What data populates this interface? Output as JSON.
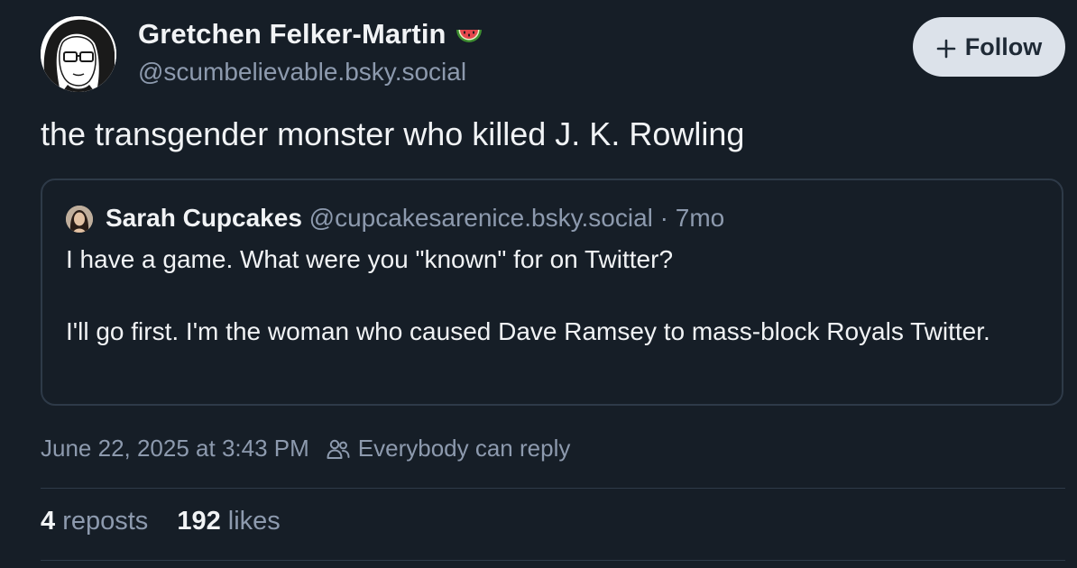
{
  "author": {
    "name": "Gretchen Felker-Martin",
    "handle": "@scumbelievable.bsky.social",
    "name_badge_icon": "watermelon-icon"
  },
  "follow_button": {
    "icon": "plus-icon",
    "label": "Follow"
  },
  "post": {
    "text": "the transgender monster who killed J. K. Rowling"
  },
  "quoted_post": {
    "author_name": "Sarah Cupcakes",
    "author_handle": "@cupcakesarenice.bsky.social",
    "separator": "·",
    "age": "7mo",
    "paragraphs": [
      "I have a game. What were you \"known\" for on Twitter?",
      "I'll go first. I'm the woman who caused Dave Ramsey to mass-block Royals Twitter."
    ]
  },
  "meta": {
    "timestamp": "June 22, 2025 at 3:43 PM",
    "reply_icon": "people-icon",
    "reply_setting": "Everybody can reply"
  },
  "stats": {
    "reposts_count": "4",
    "reposts_label": "reposts",
    "likes_count": "192",
    "likes_label": "likes"
  },
  "colors": {
    "background": "#161e27",
    "text_primary": "#f1f3f5",
    "text_secondary": "#8d9aae",
    "border": "#2e3a48",
    "follow_button_bg": "#dce2ea",
    "follow_button_text": "#1f2a36"
  }
}
